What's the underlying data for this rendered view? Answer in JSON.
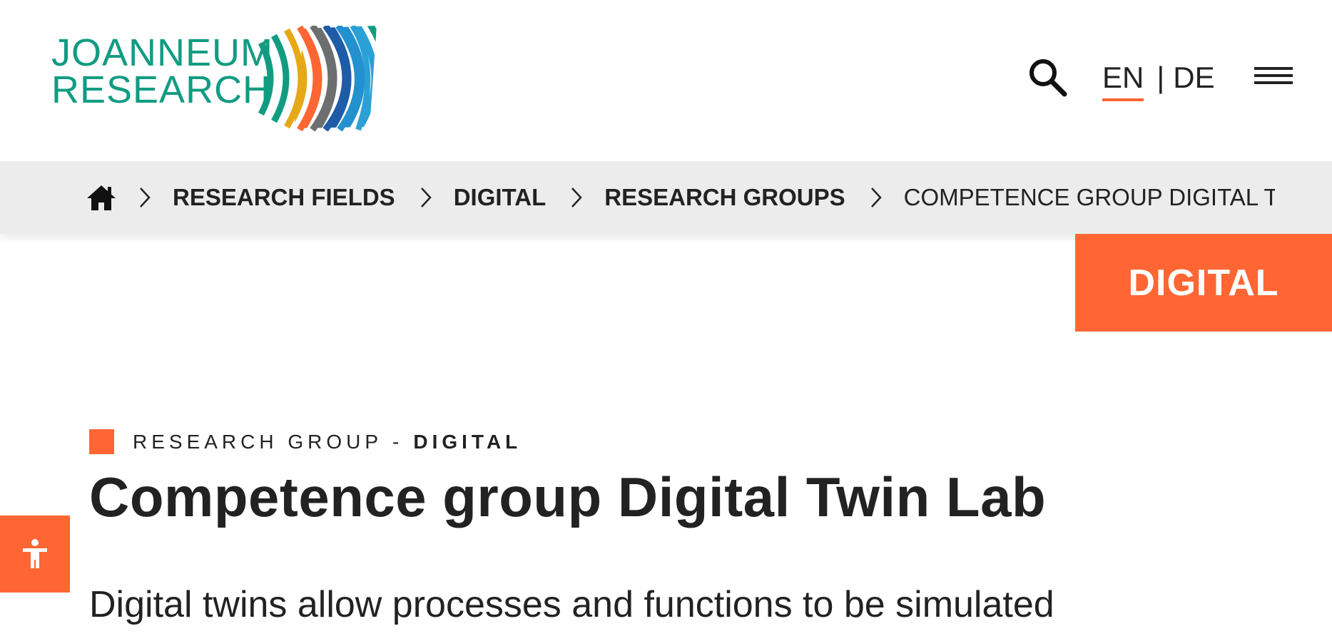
{
  "header": {
    "logo": {
      "line1": "JOANNEUM",
      "line2": "RESEARCH"
    },
    "language": {
      "active": "EN",
      "separator": "|",
      "other": "DE"
    },
    "icons": {
      "search": "search-icon",
      "menu": "hamburger-menu-icon"
    }
  },
  "breadcrumb": {
    "home_icon": "home-icon",
    "items": [
      {
        "label": "RESEARCH FIELDS"
      },
      {
        "label": "DIGITAL"
      },
      {
        "label": "RESEARCH GROUPS"
      }
    ],
    "current": "COMPETENCE GROUP DIGITAL TW"
  },
  "category_tab": {
    "label": "DIGITAL"
  },
  "main": {
    "eyebrow": {
      "prefix": "RESEARCH GROUP",
      "dash": "-",
      "category": "DIGITAL"
    },
    "title": "Competence group Digital Twin Lab",
    "intro": "Digital twins allow processes and functions to be simulated"
  },
  "accessibility": {
    "icon": "accessibility-icon"
  },
  "colors": {
    "accent": "#ff6633",
    "logo_green": "#119c82",
    "breadcrumb_bg": "#ececec",
    "text": "#222222"
  }
}
